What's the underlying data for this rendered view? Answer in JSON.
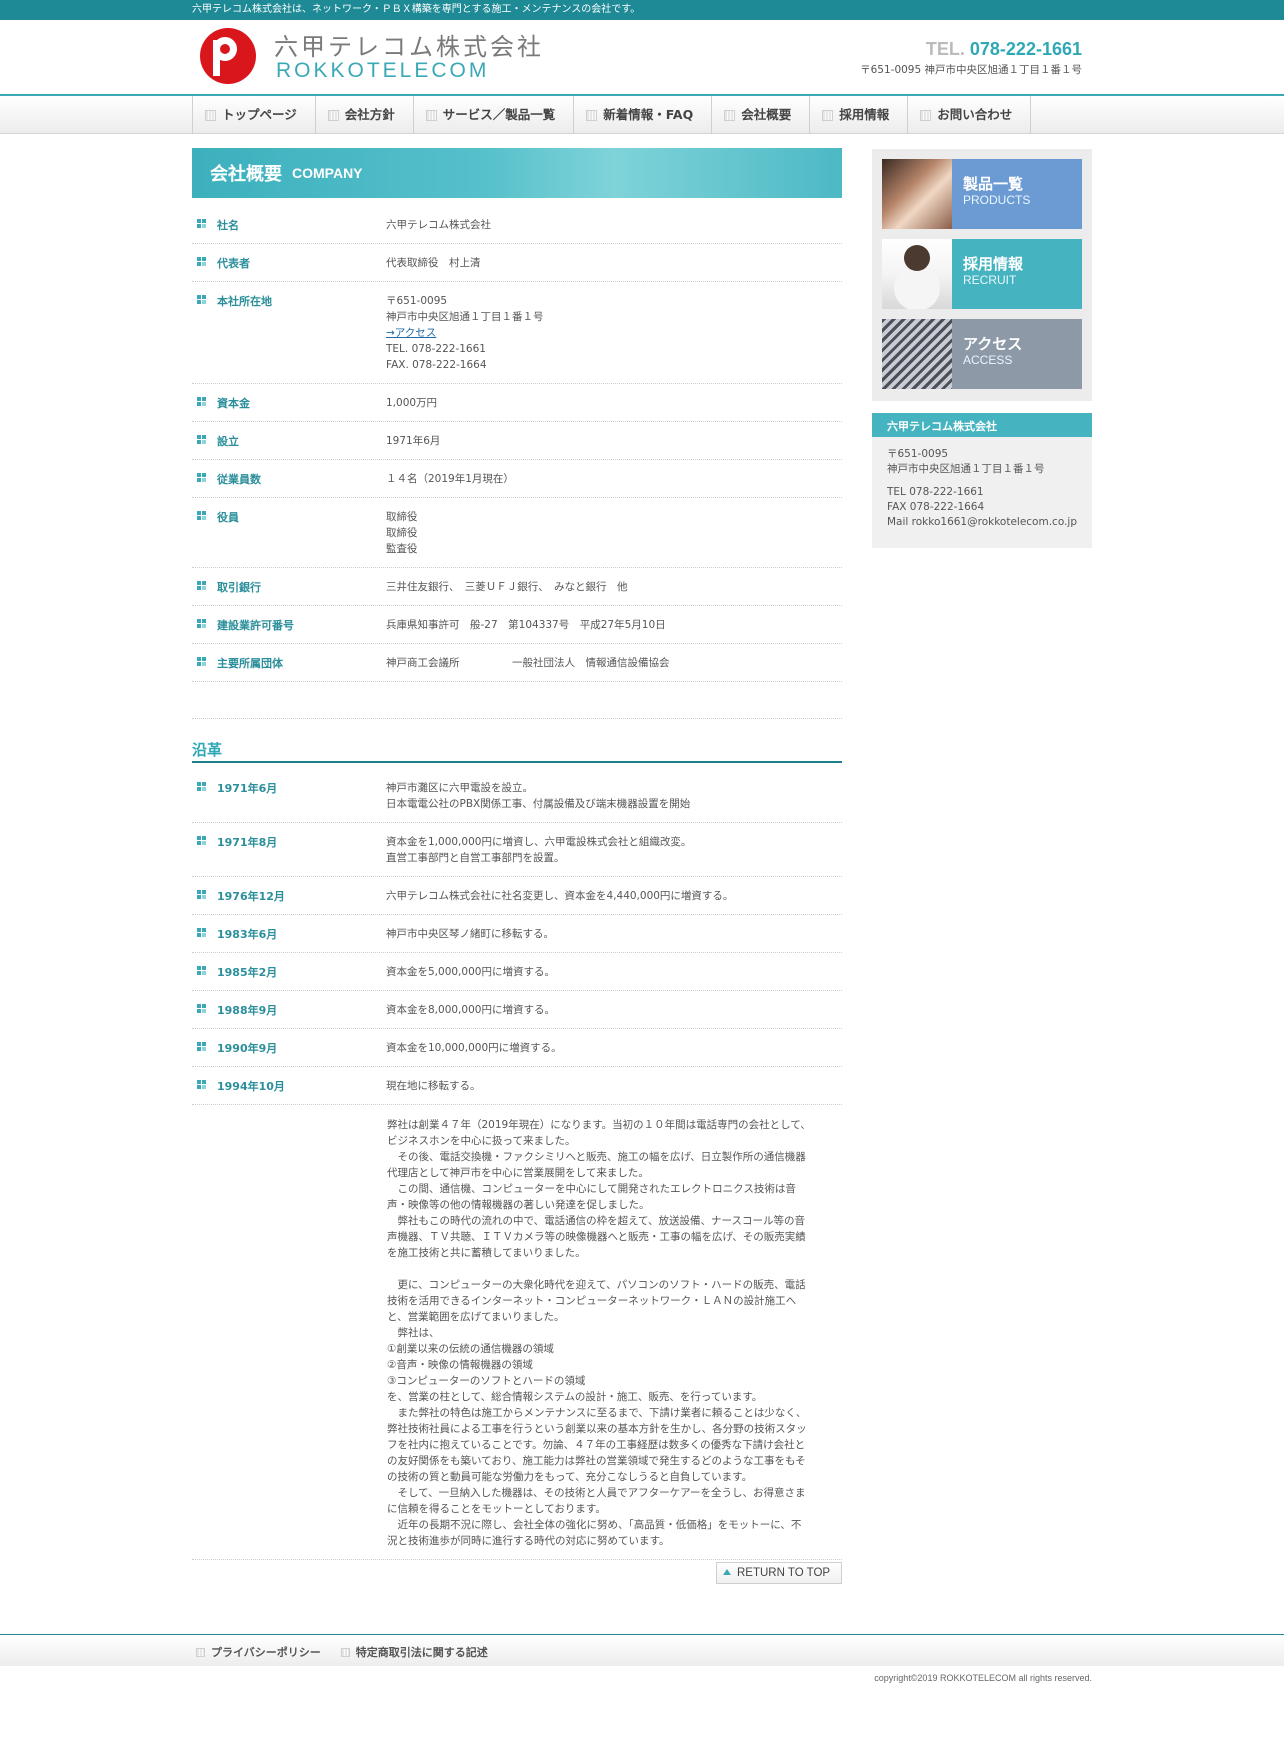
{
  "topbar": {
    "text": "六甲テレコム株式会社は、ネットワーク・ＰＢＸ構築を専門とする施工・メンテナンスの会社です。"
  },
  "header": {
    "logo_jp": "六甲テレコム株式会社",
    "logo_en": "ROKKOTELECOM",
    "tel_label": "TEL.",
    "tel_number": "078-222-1661",
    "address": "〒651-0095 神戸市中央区旭通１丁目１番１号"
  },
  "nav": {
    "items": [
      {
        "label": "トップページ"
      },
      {
        "label": "会社方針"
      },
      {
        "label": "サービス／製品一覧"
      },
      {
        "label": "新着情報・FAQ"
      },
      {
        "label": "会社概要"
      },
      {
        "label": "採用情報"
      },
      {
        "label": "お問い合わせ"
      }
    ]
  },
  "page_title": {
    "jp": "会社概要",
    "en": "COMPANY"
  },
  "company": {
    "rows": [
      {
        "label": "社名",
        "value": "六甲テレコム株式会社"
      },
      {
        "label": "代表者",
        "value": "代表取締役　村上清"
      },
      {
        "label": "本社所在地",
        "lines": [
          "〒651-0095",
          "神戸市中央区旭通１丁目１番１号"
        ],
        "link": "→アクセス",
        "lines2": [
          "TEL. 078-222-1661",
          "FAX. 078-222-1664"
        ]
      },
      {
        "label": "資本金",
        "value": "1,000万円"
      },
      {
        "label": "設立",
        "value": "1971年6月"
      },
      {
        "label": "従業員数",
        "value": "１４名（2019年1月現在）"
      },
      {
        "label": "役員",
        "lines": [
          "取締役",
          "取締役",
          "監査役"
        ]
      },
      {
        "label": "取引銀行",
        "value": "三井住友銀行、　三菱ＵＦＪ銀行、　みなと銀行　他"
      },
      {
        "label": "建設業許可番号",
        "value": "兵庫県知事許可　般-27　第104337号　平成27年5月10日"
      },
      {
        "label": "主要所属団体",
        "value": "神戸商工会議所　　　　　一般社団法人　情報通信設備協会"
      }
    ]
  },
  "history": {
    "title": "沿革",
    "rows": [
      {
        "date": "1971年6月",
        "lines": [
          "神戸市灘区に六甲電設を設立。",
          "日本電電公社のPBX関係工事、付属設備及び端末機器設置を開始"
        ]
      },
      {
        "date": "1971年8月",
        "lines": [
          "資本金を1,000,000円に増資し、六甲電設株式会社と組織改変。",
          "直営工事部門と自営工事部門を設置。"
        ]
      },
      {
        "date": "1976年12月",
        "lines": [
          "六甲テレコム株式会社に社名変更し、資本金を4,440,000円に増資する。"
        ]
      },
      {
        "date": "1983年6月",
        "lines": [
          "神戸市中央区琴ノ緒町に移転する。"
        ]
      },
      {
        "date": "1985年2月",
        "lines": [
          "資本金を5,000,000円に増資する。"
        ]
      },
      {
        "date": "1988年9月",
        "lines": [
          "資本金を8,000,000円に増資する。"
        ]
      },
      {
        "date": "1990年9月",
        "lines": [
          "資本金を10,000,000円に増資する。"
        ]
      },
      {
        "date": "1994年10月",
        "lines": [
          "現在地に移転する。"
        ]
      }
    ],
    "paragraph": "弊社は創業４７年（2019年現在）になります。当初の１０年間は電話専門の会社として、\nビジネスホンを中心に扱って来ました。\n　その後、電話交換機・ファクシミリへと販売、施工の幅を広げ、日立製作所の通信機器\n代理店として神戸市を中心に営業展開をして来ました。\n　この間、通信機、コンピューターを中心にして開発されたエレクトロニクス技術は音\n声・映像等の他の情報機器の著しい発達を促しました。\n　弊社もこの時代の流れの中で、電話通信の枠を超えて、放送設備、ナースコール等の音\n声機器、ＴＶ共聴、ＩＴＶカメラ等の映像機器へと販売・工事の幅を広げ、その販売実績\nを施工技術と共に蓄積してまいりました。\n\n　更に、コンピューターの大衆化時代を迎えて、パソコンのソフト・ハードの販売、電話\n技術を活用できるインターネット・コンピューターネットワーク・ＬＡＮの設計施工へ\nと、営業範囲を広げてまいりました。\n　弊社は、\n①創業以来の伝統の通信機器の領域\n②音声・映像の情報機器の領域\n③コンピューターのソフトとハードの領域\nを、営業の柱として、総合情報システムの設計・施工、販売、を行っています。\n　また弊社の特色は施工からメンテナンスに至るまで、下請け業者に頼ることは少なく、\n弊社技術社員による工事を行うという創業以来の基本方針を生かし、各分野の技術スタッ\nフを社内に抱えていることです。勿論、４７年の工事経歴は数多くの優秀な下請け会社と\nの友好関係をも築いており、施工能力は弊社の営業領域で発生するどのような工事をもそ\nの技術の質と動員可能な労働力をもって、充分こなしうると自負しています。\n　そして、一旦納入した機器は、その技術と人員でアフターケアーを全うし、お得意さま\nに信頼を得ることをモットーとしております。\n　近年の長期不況に際し、会社全体の強化に努め、「高品質・低価格」をモットーに、不\n況と技術進歩が同時に進行する時代の対応に努めています。"
  },
  "return_to_top": "RETURN TO TOP",
  "sidebar": {
    "banners": [
      {
        "jp": "製品一覧",
        "en": "PRODUCTS"
      },
      {
        "jp": "採用情報",
        "en": "RECRUIT"
      },
      {
        "jp": "アクセス",
        "en": "ACCESS"
      }
    ],
    "company_box": {
      "title": "六甲テレコム株式会社",
      "postal": "〒651-0095",
      "address": "神戸市中央区旭通１丁目１番１号",
      "tel": "TEL 078-222-1661",
      "fax": "FAX 078-222-1664",
      "mail": "Mail rokko1661@rokkotelecom.co.jp"
    }
  },
  "footer": {
    "links": [
      {
        "label": "プライバシーポリシー"
      },
      {
        "label": "特定商取引法に関する記述"
      }
    ],
    "copyright": "copyright©2019 ROKKOTELECOM all rights reserved."
  },
  "colors": {
    "accent": "#3aa9b5",
    "topbar": "#1e8a96",
    "products": "#6c9bd4",
    "recruit": "#46b4c0",
    "access": "#8d99a7"
  }
}
